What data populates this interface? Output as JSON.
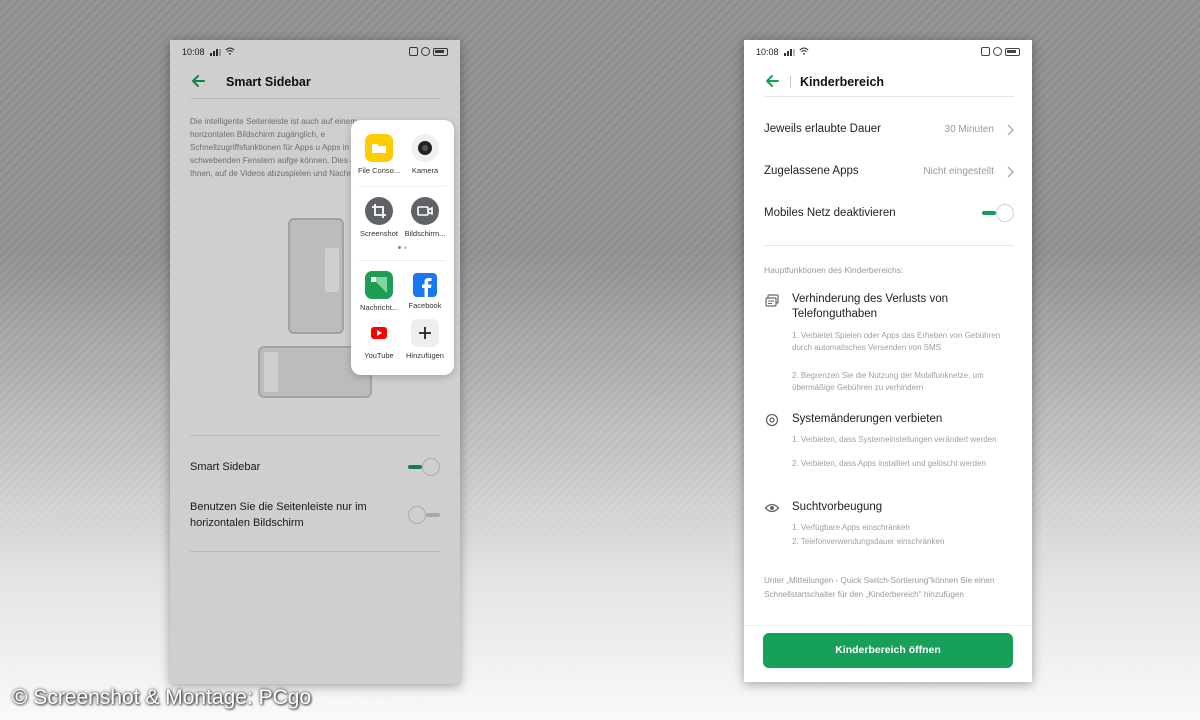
{
  "colors": {
    "accent": "#17a05a",
    "toggle_on": "#1a9c59"
  },
  "left_phone": {
    "status": {
      "time": "10:08"
    },
    "title": "Smart Sidebar",
    "description": "Die intelligente Seitenleiste ist auch auf einem horizontalen Bildschirm zugänglich, e Schnellzugriffsfunktionen für Apps u Apps in schwebenden Fenstern aufge können. Dies ermöglicht Ihnen, auf de Videos abzuspielen und Nachrichten",
    "sidebar": {
      "items": [
        {
          "label": "File Conso...",
          "icon": "folder-icon"
        },
        {
          "label": "Kamera",
          "icon": "camera-icon"
        },
        {
          "label": "Screenshot",
          "icon": "crop-icon"
        },
        {
          "label": "Bildschirm...",
          "icon": "video-icon"
        },
        {
          "label": "Nachricht...",
          "icon": "message-icon"
        },
        {
          "label": "Facebook",
          "icon": "facebook-icon"
        },
        {
          "label": "YouTube",
          "icon": "youtube-icon"
        },
        {
          "label": "Hinzufügen",
          "icon": "plus-icon"
        }
      ]
    },
    "settings": {
      "smart_sidebar": {
        "label": "Smart Sidebar",
        "enabled": true
      },
      "horizontal_only": {
        "label": "Benutzen Sie die Seitenleiste nur im horizontalen Bildschirm",
        "enabled": false
      }
    }
  },
  "right_phone": {
    "status": {
      "time": "10:08"
    },
    "title": "Kinderbereich",
    "rows": [
      {
        "label": "Jeweils erlaubte Dauer",
        "value": "30 Minuten"
      },
      {
        "label": "Zugelassene Apps",
        "value": "Nicht eingestellt"
      }
    ],
    "mobile_data": {
      "label": "Mobiles Netz deaktivieren",
      "enabled": true
    },
    "section_header": "Hauptfunktionen des Kinderbereichs:",
    "features": [
      {
        "icon": "messages-icon",
        "title": "Verhinderung des Verlusts von Telefonguthaben",
        "text1": "1. Verbietet Spielen oder Apps das Erheben von Gebühren durch automatisches Versenden von SMS",
        "text2": "2. Begrenzen Sie die Nutzung der Mobilfunknetze, um übermäßige Gebühren zu verhindern"
      },
      {
        "icon": "settings-icon",
        "title": "Systemänderungen verbieten",
        "text1": "1. Verbieten, dass Systemeinstellungen verändert werden",
        "text2": "2. Verbieten, dass Apps installiert und gelöscht werden"
      },
      {
        "icon": "eye-icon",
        "title": "Suchtvorbeugung",
        "text1": "1. Verfügbare Apps einschränken",
        "text2": "2. Telefonverwendungsdauer einschränken"
      }
    ],
    "note": "Unter „Mitteilungen - Quick Switch-Sortierung\"können Sie einen Schnellstartschalter für den „Kinderbereich\" hinzufügen",
    "button": "Kinderbereich öffnen"
  },
  "watermark": "© Screenshot & Montage: PCgo"
}
